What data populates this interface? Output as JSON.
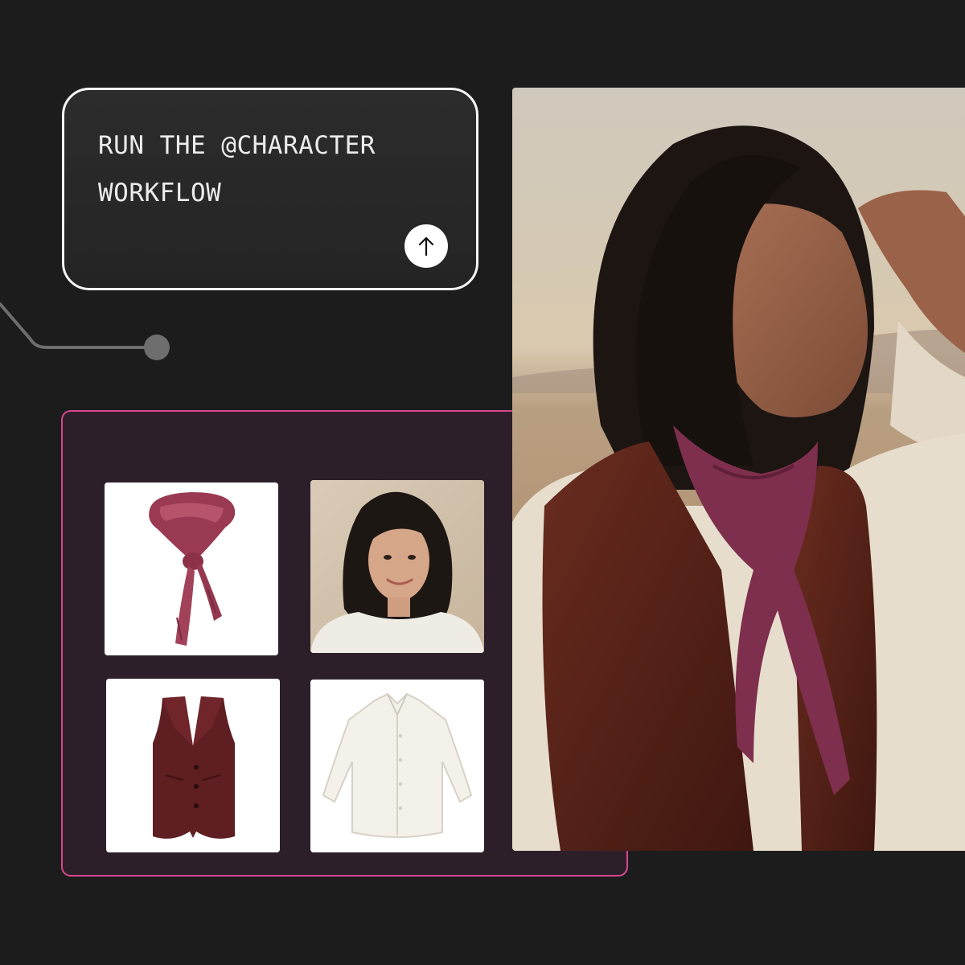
{
  "prompt": {
    "text": "RUN THE @CHARACTER\nWORKFLOW"
  },
  "icons": {
    "submit": "arrow-up-icon"
  },
  "colors": {
    "background": "#1c1c1c",
    "prompt_border": "#f4f4f4",
    "panel_border": "#d6478f",
    "panel_fill": "#2d1f29",
    "connector": "#6e6e6e"
  },
  "reference_items": [
    {
      "name": "scarf",
      "kind": "product-image"
    },
    {
      "name": "portrait",
      "kind": "character-image"
    },
    {
      "name": "vest",
      "kind": "product-image"
    },
    {
      "name": "shirt",
      "kind": "product-image"
    }
  ]
}
